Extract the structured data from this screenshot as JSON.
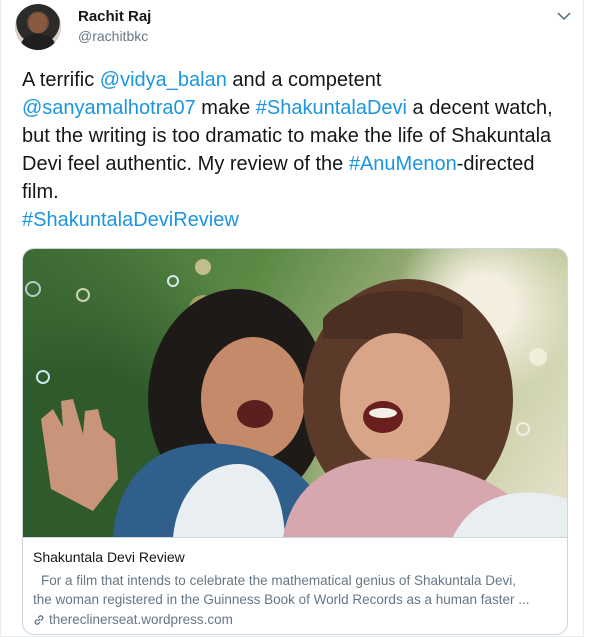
{
  "author": {
    "name": "Rachit Raj",
    "handle": "@rachitbkc"
  },
  "tweet": {
    "t1": "A terrific ",
    "m1": "@vidya_balan",
    "t2": " and a competent ",
    "m2": "@sanyamalhotra07",
    "t3": " make ",
    "h1": "#ShakuntalaDevi",
    "t4": " a decent watch, but the writing is too dramatic to make the life of Shakuntala Devi feel authentic. My review of the ",
    "h2": "#AnuMenon",
    "t5": "-directed film.",
    "h3": "#ShakuntalaDeviReview"
  },
  "card": {
    "title": "Shakuntala Devi Review",
    "desc_line1": "For a film that intends to celebrate the mathematical genius of Shakuntala Devi,",
    "desc_line2": "the woman registered in the Guinness Book of World Records as a human faster ...",
    "url": "thereclinerseat.wordpress.com"
  },
  "icons": {
    "menu": "chevron-down-icon",
    "link": "link-icon"
  },
  "colors": {
    "link": "#1b95e0",
    "text": "#14171a",
    "muted": "#657786",
    "border": "#ccd6dd"
  }
}
